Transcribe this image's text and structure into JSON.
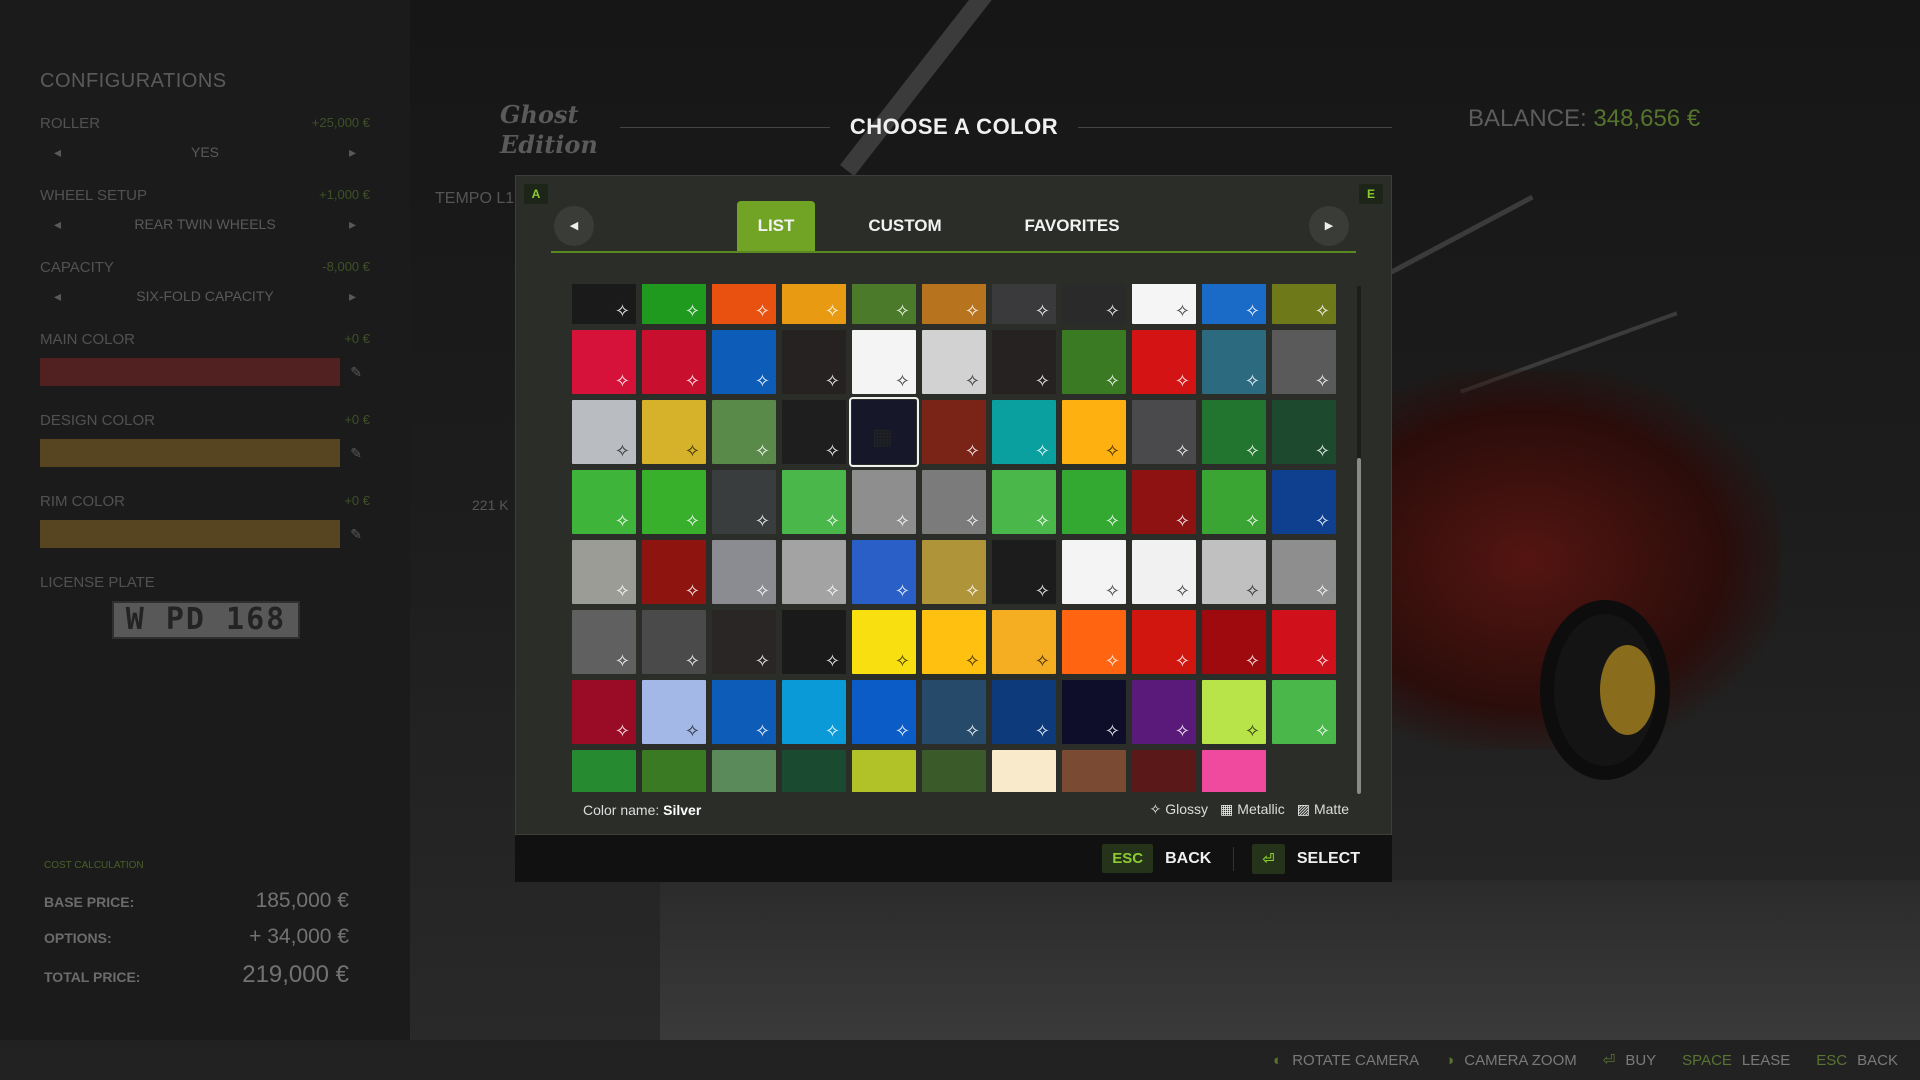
{
  "configurations": {
    "title": "CONFIGURATIONS",
    "items": [
      {
        "label": "ROLLER",
        "price": "+25,000 €",
        "value": "YES"
      },
      {
        "label": "WHEEL SETUP",
        "price": "+1,000 €",
        "value": "REAR TWIN WHEELS"
      },
      {
        "label": "CAPACITY",
        "price": "-8,000 €",
        "value": "SIX-FOLD CAPACITY"
      }
    ],
    "colors": [
      {
        "label": "MAIN COLOR",
        "price": "+0 €",
        "color": "#b52a2a"
      },
      {
        "label": "DESIGN COLOR",
        "price": "+0 €",
        "color": "#c7902a"
      },
      {
        "label": "RIM COLOR",
        "price": "+0 €",
        "color": "#c7902a"
      }
    ],
    "license_plate_label": "LICENSE PLATE",
    "license_plate": "W PD 168"
  },
  "cost": {
    "caption": "COST CALCULATION",
    "base_label": "BASE PRICE:",
    "base_value": "185,000 €",
    "options_label": "OPTIONS:",
    "options_value": "+ 34,000 €",
    "total_label": "TOTAL PRICE:",
    "total_value": "219,000 €"
  },
  "background": {
    "logo_line1": "Ghost",
    "logo_line2": "Edition",
    "tempo": "TEMPO L1",
    "weight": "221 K",
    "balance_label": "BALANCE:",
    "balance_value": "348,656 €"
  },
  "modal": {
    "title": "CHOOSE A COLOR",
    "key_left": "A",
    "key_right": "E",
    "tabs": [
      "LIST",
      "CUSTOM",
      "FAVORITES"
    ],
    "active_tab": "LIST",
    "color_name_label": "Color name:",
    "color_name_value": "Silver",
    "legend": {
      "glossy": "Glossy",
      "metallic": "Metallic",
      "matte": "Matte"
    },
    "footer": {
      "esc_key": "ESC",
      "back": "BACK",
      "select_key": "⏎",
      "select": "SELECT"
    },
    "selected_index": 26,
    "swatches": [
      "#1a1a1a",
      "#1f9a1f",
      "#e8510f",
      "#e89a12",
      "#4a7a2a",
      "#b8731e",
      "#3a3a3d",
      "#2a2a2a",
      "#f5f5f5",
      "#1a6ac8",
      "#6e7a1a",
      "#d6123a",
      "#c8102e",
      "#0c5cb8",
      "#262222",
      "#f4f4f4",
      "#d2d2d2",
      "#262222",
      "#3a7a22",
      "#d41414",
      "#2c6a80",
      "#5a5a5a",
      "#b9bcc0",
      "#d6b22a",
      "#5a8a4a",
      "#1e1e1e",
      "#16182a",
      "#7a2418",
      "#0aa0a0",
      "#fdb010",
      "#4a4a4d",
      "#21752e",
      "#1d4a2e",
      "#3eb43a",
      "#38b02c",
      "#3a3d3d",
      "#4ab74a",
      "#8e8e8e",
      "#7b7b7b",
      "#4ab74a",
      "#33a932",
      "#8e1212",
      "#3ba533",
      "#0f3f8f",
      "#9c9c96",
      "#8e1410",
      "#8b8c92",
      "#a3a3a3",
      "#2a5fc8",
      "#b0943a",
      "#1c1c1c",
      "#f4f4f4",
      "#f1f1f1",
      "#c0c0c0",
      "#8e8e8e",
      "#606060",
      "#4a4a4a",
      "#2a2626",
      "#1a1a1a",
      "#f8e010",
      "#ffc010",
      "#f5ae22",
      "#ff6410",
      "#d0160e",
      "#9f0a0e",
      "#d0101a",
      "#9a0c26",
      "#a3b8e6",
      "#0c5cb8",
      "#0a9ad8",
      "#0c5cc8",
      "#254a6a",
      "#0d3a7a",
      "#0e0e2a",
      "#5a1a7a",
      "#b8e44a",
      "#4ab74a",
      "#258a30",
      "#3a7a22",
      "#5a8a5a",
      "#1a4a30",
      "#b0c228",
      "#3a5a2a",
      "#f8eacb",
      "#7a4a32",
      "#5a1818",
      "#f04a9e",
      null
    ]
  },
  "action_bar": {
    "rotate": "ROTATE CAMERA",
    "zoom": "CAMERA ZOOM",
    "buy": "BUY",
    "lease_key": "SPACE",
    "lease": "LEASE",
    "back_key": "ESC",
    "back": "BACK"
  }
}
